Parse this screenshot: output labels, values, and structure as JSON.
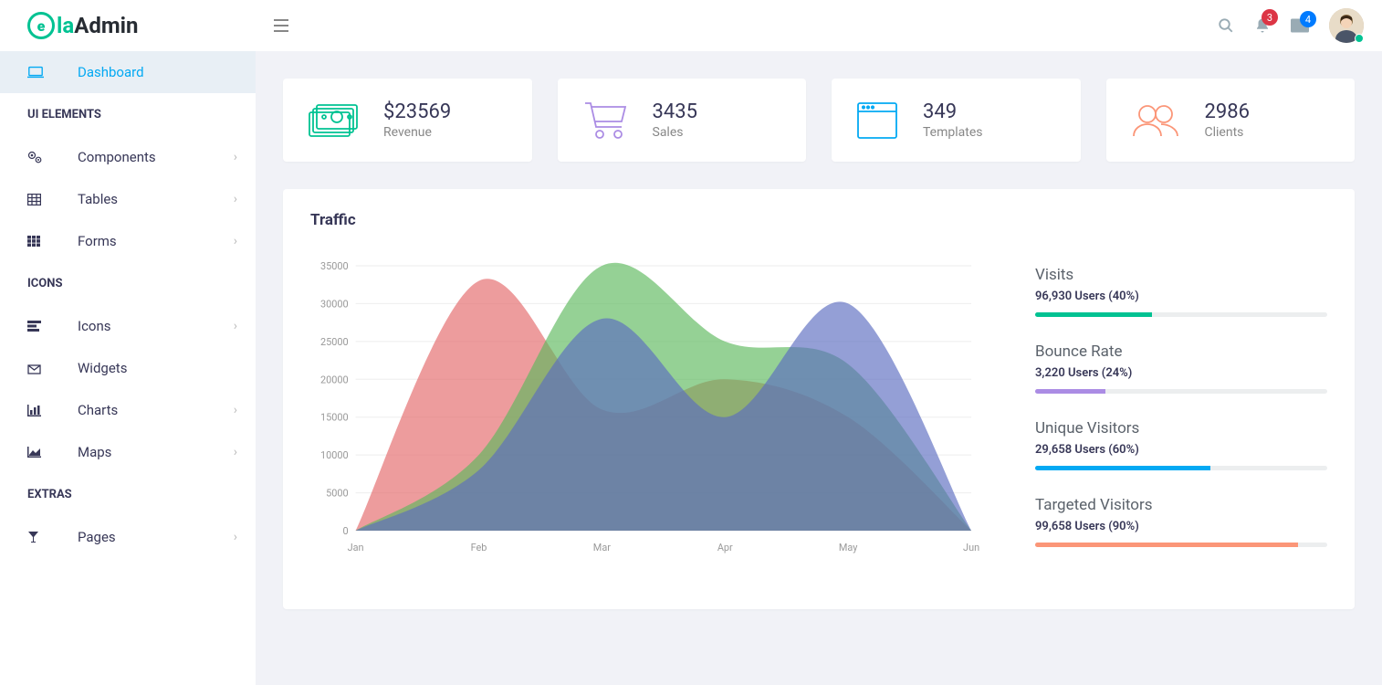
{
  "logo": {
    "brand_la": "la",
    "brand_admin": "Admin"
  },
  "header": {
    "notif_badge": "3",
    "mail_badge": "4"
  },
  "sidebar": {
    "dashboard": "Dashboard",
    "section_ui": "UI ELEMENTS",
    "components": "Components",
    "tables": "Tables",
    "forms": "Forms",
    "section_icons": "ICONS",
    "icons": "Icons",
    "widgets": "Widgets",
    "charts": "Charts",
    "maps": "Maps",
    "section_extras": "EXTRAS",
    "pages": "Pages"
  },
  "stats": {
    "revenue": {
      "value": "$23569",
      "label": "Revenue"
    },
    "sales": {
      "value": "3435",
      "label": "Sales"
    },
    "templates": {
      "value": "349",
      "label": "Templates"
    },
    "clients": {
      "value": "2986",
      "label": "Clients"
    }
  },
  "traffic": {
    "title": "Traffic",
    "progress": {
      "visits": {
        "title": "Visits",
        "sub": "96,930 Users (40%)",
        "pct": 40
      },
      "bounce": {
        "title": "Bounce Rate",
        "sub": "3,220 Users (24%)",
        "pct": 24
      },
      "unique": {
        "title": "Unique Visitors",
        "sub": "29,658 Users (60%)",
        "pct": 60
      },
      "targeted": {
        "title": "Targeted Visitors",
        "sub": "99,658 Users (90%)",
        "pct": 90
      }
    }
  },
  "chart_data": {
    "type": "area",
    "title": "Traffic",
    "xlabel": "",
    "ylabel": "",
    "ylim": [
      0,
      35000
    ],
    "categories": [
      "Jan",
      "Feb",
      "Mar",
      "Apr",
      "May",
      "Jun"
    ],
    "series": [
      {
        "name": "Red",
        "color": "#e36768",
        "values": [
          0,
          33000,
          16000,
          20000,
          15000,
          0
        ]
      },
      {
        "name": "Green",
        "color": "#5cb85c",
        "values": [
          0,
          10000,
          35000,
          25000,
          22000,
          0
        ]
      },
      {
        "name": "Blue",
        "color": "#5b6bc0",
        "values": [
          0,
          8000,
          28000,
          15000,
          30000,
          0
        ]
      }
    ]
  }
}
